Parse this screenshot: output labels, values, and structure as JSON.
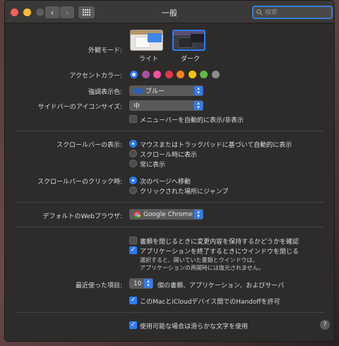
{
  "window": {
    "title": "一般"
  },
  "search": {
    "placeholder": "検索"
  },
  "appearance": {
    "label": "外観モード:",
    "options": [
      "ライト",
      "ダーク"
    ],
    "selected": "ダーク"
  },
  "accent": {
    "label": "アクセントカラー:",
    "colors": [
      "#2f7bf6",
      "#a550a7",
      "#f74f9e",
      "#e0384b",
      "#f7821b",
      "#ffc600",
      "#62ba46",
      "#8c8c8c"
    ],
    "selected": 0
  },
  "highlight": {
    "label": "強調表示色:",
    "value": "ブルー",
    "swatch_color": "#2f62b0"
  },
  "sidebar_icon": {
    "label": "サイドバーのアイコンサイズ:",
    "value": "中"
  },
  "menubar": {
    "label": "メニューバーを自動的に表示/非表示",
    "checked": false
  },
  "scroll_show": {
    "label": "スクロールバーの表示:",
    "options": [
      "マウスまたはトラックパッドに基づいて自動的に表示",
      "スクロール時に表示",
      "常に表示"
    ],
    "selected": 0
  },
  "scroll_click": {
    "label": "スクロールバーのクリック時:",
    "options": [
      "次のページへ移動",
      "クリックされた場所にジャンプ"
    ],
    "selected": 0
  },
  "browser": {
    "label": "デフォルトのWebブラウザ:",
    "value": "Google Chrome"
  },
  "docs": {
    "ask_changes": {
      "label": "書類を閉じるときに変更内容を保持するかどうかを確認",
      "checked": false
    },
    "close_windows": {
      "label": "アプリケーションを終了するときにウインドウを閉じる",
      "checked": true
    },
    "note_line1": "選択すると、開いていた書類とウインドウは、",
    "note_line2": "アプリケーションの再開時には復元されません。"
  },
  "recent": {
    "label": "最近使った項目:",
    "value": "10",
    "suffix": "個の書類、アプリケーション、およびサーバ"
  },
  "handoff": {
    "label": "このMacとiCloudデバイス間でのHandoffを許可",
    "checked": true
  },
  "smooth_fonts": {
    "label": "使用可能な場合は滑らかな文字を使用",
    "checked": true
  },
  "help": {
    "label": "?"
  }
}
